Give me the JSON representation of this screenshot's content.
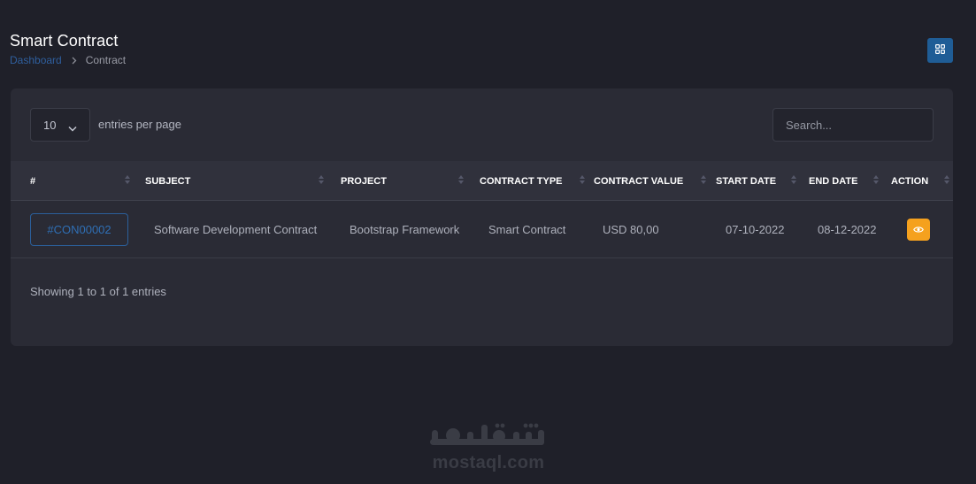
{
  "header": {
    "title": "Smart Contract",
    "breadcrumb": [
      "Dashboard",
      "Contract"
    ]
  },
  "controls": {
    "per_page_value": "10",
    "per_page_label": "entries per page",
    "search_placeholder": "Search..."
  },
  "table": {
    "columns": [
      "#",
      "SUBJECT",
      "PROJECT",
      "CONTRACT TYPE",
      "CONTRACT VALUE",
      "START DATE",
      "END DATE",
      "ACTION"
    ],
    "rows": [
      {
        "id": "#CON00002",
        "subject": "Software Development Contract",
        "project": "Bootstrap Framework",
        "contract_type": "Smart Contract",
        "contract_value": "USD 80,00",
        "start_date": "07-10-2022",
        "end_date": "08-12-2022",
        "action_icon": "eye-icon"
      }
    ]
  },
  "footer": {
    "showing": "Showing 1 to 1 of 1 entries"
  },
  "watermark": {
    "text": "mostaql.com",
    "logo_text": "مستقل"
  },
  "colors": {
    "background": "#1f2029",
    "card": "#2a2b35",
    "accent_blue": "#1f5d96",
    "action_orange": "#f5a11e"
  }
}
